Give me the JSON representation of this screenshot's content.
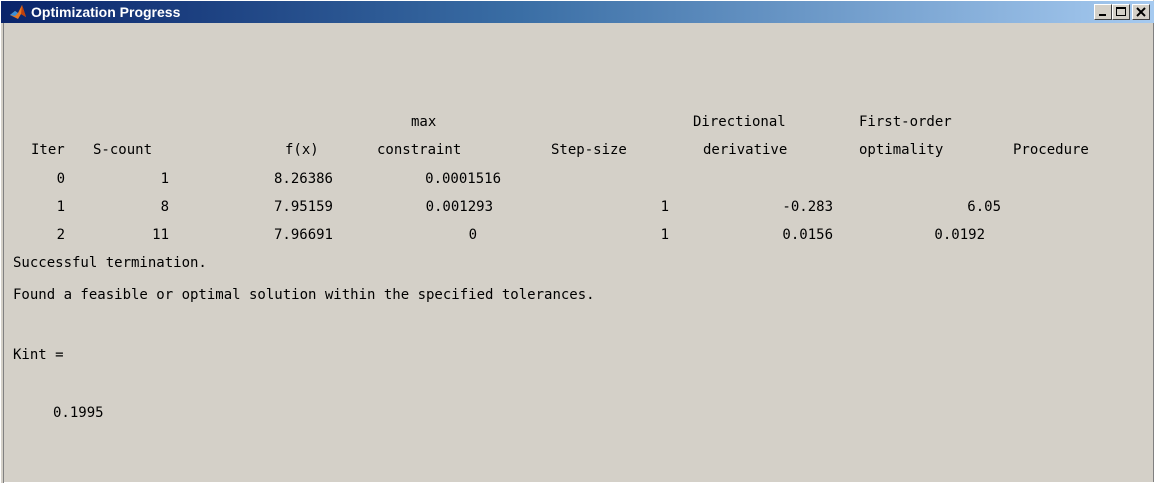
{
  "window": {
    "title": "Optimization Progress",
    "icon": "matlab-icon",
    "buttons": [
      "minimize-icon",
      "maximize-icon",
      "close-icon"
    ]
  },
  "table": {
    "header_top": {
      "max": "max",
      "directional": "Directional",
      "first_order": "First-order"
    },
    "header_bottom": {
      "iter": "Iter",
      "scount": "S-count",
      "fx": "f(x)",
      "constraint": "constraint",
      "step_size": "Step-size",
      "derivative": "derivative",
      "optimality": "optimality",
      "procedure": "Procedure"
    },
    "rows": [
      {
        "iter": "0",
        "scount": "1",
        "fx": "8.26386",
        "constraint": "0.0001516",
        "step_size": "",
        "derivative": "",
        "optimality": "",
        "procedure": ""
      },
      {
        "iter": "1",
        "scount": "8",
        "fx": "7.95159",
        "constraint": "0.001293",
        "step_size": "1",
        "derivative": "-0.283",
        "optimality": "6.05",
        "procedure": ""
      },
      {
        "iter": "2",
        "scount": "11",
        "fx": "7.96691",
        "constraint": "0",
        "step_size": "1",
        "derivative": "0.0156",
        "optimality": "0.0192",
        "procedure": ""
      }
    ]
  },
  "messages": {
    "line1": "Successful termination.",
    "line2": "Found a feasible or optimal solution within the specified tolerances."
  },
  "result": {
    "var_line": "Kint =",
    "value": "0.1995"
  }
}
